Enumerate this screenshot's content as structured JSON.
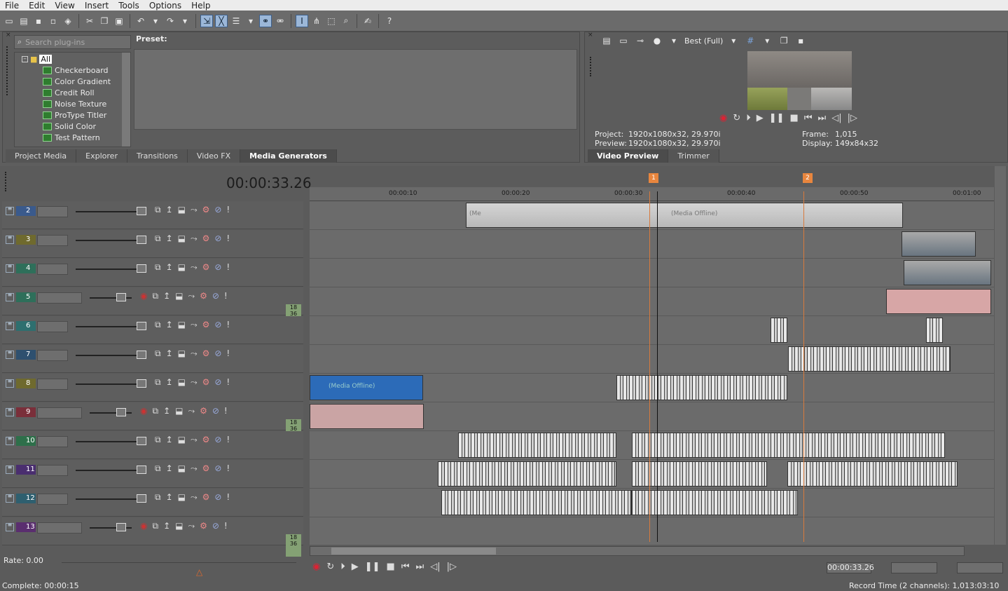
{
  "menu": [
    "File",
    "Edit",
    "View",
    "Insert",
    "Tools",
    "Options",
    "Help"
  ],
  "plugins": {
    "search_placeholder": "Search plug-ins",
    "root": "All",
    "items": [
      "Checkerboard",
      "Color Gradient",
      "Credit Roll",
      "Noise Texture",
      "ProType Titler",
      "Solid Color",
      "Test Pattern"
    ],
    "preset_label": "Preset:",
    "tabs": [
      "Project Media",
      "Explorer",
      "Transitions",
      "Video FX",
      "Media Generators"
    ],
    "active_tab": "Media Generators"
  },
  "preview": {
    "quality": "Best (Full)",
    "project_label": "Project:",
    "project_value": "1920x1080x32, 29.970i",
    "preview_label": "Preview:",
    "preview_value": "1920x1080x32, 29.970i",
    "frame_label": "Frame:",
    "frame_value": "1,015",
    "display_label": "Display:",
    "display_value": "149x84x32",
    "tabs": [
      "Video Preview",
      "Trimmer"
    ],
    "active_tab": "Video Preview"
  },
  "timeline": {
    "time": "00:00:33.26",
    "ruler": [
      "00:00:10",
      "00:00:20",
      "00:00:30",
      "00:00:40",
      "00:00:50",
      "00:01:00"
    ],
    "markers": [
      "1",
      "2"
    ],
    "tracks": [
      {
        "num": "2",
        "type": "video",
        "color": "#3a5a8c"
      },
      {
        "num": "3",
        "type": "video",
        "color": "#6f6a2e"
      },
      {
        "num": "4",
        "type": "video",
        "color": "#2e6f5a"
      },
      {
        "num": "5",
        "type": "audio",
        "color": "#2e6f5a",
        "thumb": "18 36"
      },
      {
        "num": "6",
        "type": "video",
        "color": "#2e6f6f"
      },
      {
        "num": "7",
        "type": "video",
        "color": "#2e506f"
      },
      {
        "num": "8",
        "type": "video",
        "color": "#6f6a2e"
      },
      {
        "num": "9",
        "type": "audio",
        "color": "#7a2f3a",
        "thumb": "18 36"
      },
      {
        "num": "10",
        "type": "video",
        "color": "#2e6f4a"
      },
      {
        "num": "11",
        "type": "video",
        "color": "#4a2e6f"
      },
      {
        "num": "12",
        "type": "video",
        "color": "#2e5f6f"
      },
      {
        "num": "13",
        "type": "audio",
        "color": "#5a2e6f",
        "thumb": "18 36"
      }
    ],
    "media_offline": "(Media Offline)",
    "media_short": "(Me"
  },
  "bottom": {
    "rate": "Rate: 0.00",
    "cursor_pos": "00:00:33.26",
    "complete": "Complete: 00:00:15",
    "record_time": "Record Time (2 channels): 1,013:03:10"
  }
}
